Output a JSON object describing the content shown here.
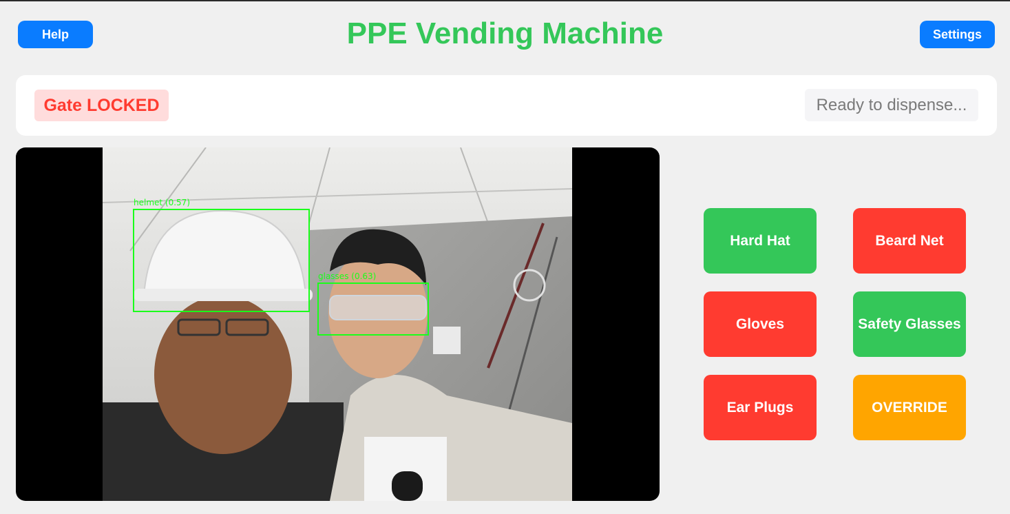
{
  "header": {
    "help_label": "Help",
    "title": "PPE Vending Machine",
    "settings_label": "Settings"
  },
  "status": {
    "gate_text": "Gate LOCKED",
    "dispense_text": "Ready to dispense..."
  },
  "camera": {
    "detections": [
      {
        "label": "helmet (0.57)"
      },
      {
        "label": "glasses (0.63)"
      }
    ]
  },
  "ppe_buttons": [
    {
      "label": "Hard Hat",
      "color": "#34c759"
    },
    {
      "label": "Beard Net",
      "color": "#ff3b30"
    },
    {
      "label": "Gloves",
      "color": "#ff3b30"
    },
    {
      "label": "Safety Glasses",
      "color": "#34c759"
    },
    {
      "label": "Ear Plugs",
      "color": "#ff3b30"
    },
    {
      "label": "OVERRIDE",
      "color": "#ffa500"
    }
  ],
  "colors": {
    "accent_blue": "#0a7cff",
    "title_green": "#34c759",
    "locked_red": "#ff3b30",
    "detection_green": "#1aff1a"
  }
}
